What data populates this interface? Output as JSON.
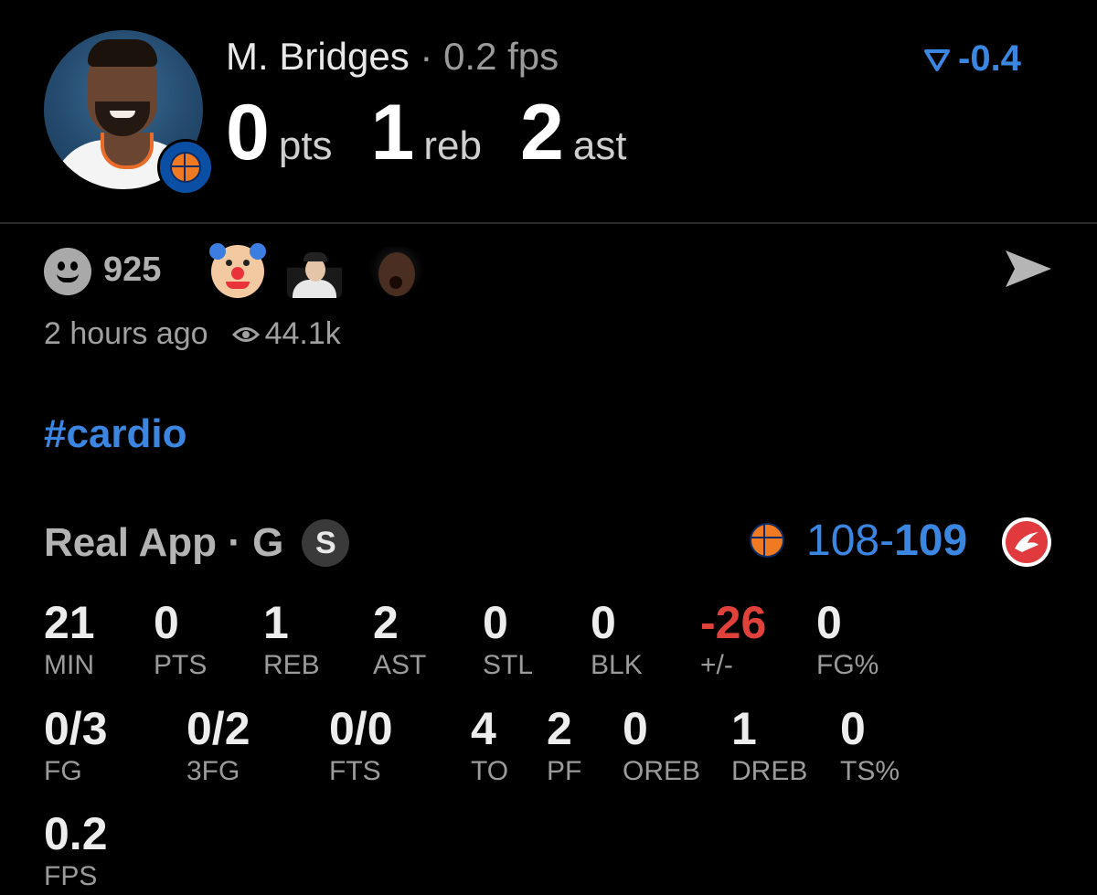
{
  "header": {
    "player_name": "M. Bridges",
    "separator": " · ",
    "fps_text": "0.2 fps",
    "pts_value": "0",
    "pts_label": "pts",
    "reb_value": "1",
    "reb_label": "reb",
    "ast_value": "2",
    "ast_label": "ast",
    "delta": "-0.4"
  },
  "reactions": {
    "count": "925",
    "time_ago": "2 hours ago",
    "views": "44.1k"
  },
  "post": {
    "hashtag": "#cardio"
  },
  "game": {
    "source": "Real App · G",
    "badge": "S",
    "score_home": "108",
    "score_dash": "-",
    "score_away": "109"
  },
  "stats_row1": [
    {
      "value": "21",
      "label": "MIN"
    },
    {
      "value": "0",
      "label": "PTS"
    },
    {
      "value": "1",
      "label": "REB"
    },
    {
      "value": "2",
      "label": "AST"
    },
    {
      "value": "0",
      "label": "STL"
    },
    {
      "value": "0",
      "label": "BLK"
    },
    {
      "value": "-26",
      "label": "+/-"
    },
    {
      "value": "0",
      "label": "FG%"
    }
  ],
  "stats_row2": [
    {
      "value": "0/3",
      "label": "FG"
    },
    {
      "value": "0/2",
      "label": "3FG"
    },
    {
      "value": "0/0",
      "label": "FTS"
    },
    {
      "value": "4",
      "label": "TO"
    },
    {
      "value": "2",
      "label": "PF"
    },
    {
      "value": "0",
      "label": "OREB"
    },
    {
      "value": "1",
      "label": "DREB"
    },
    {
      "value": "0",
      "label": "TS%"
    }
  ],
  "stats_row3": [
    {
      "value": "0.2",
      "label": "FPS"
    }
  ],
  "colors": {
    "accent_blue": "#3a86e0",
    "negative_red": "#e0413a",
    "knicks_orange": "#f07a22",
    "hawks_red": "#e03a3e"
  },
  "icons": {
    "delta": "filter-down-icon",
    "reaction": "smiley-icon",
    "share": "send-icon",
    "views": "eye-icon"
  }
}
